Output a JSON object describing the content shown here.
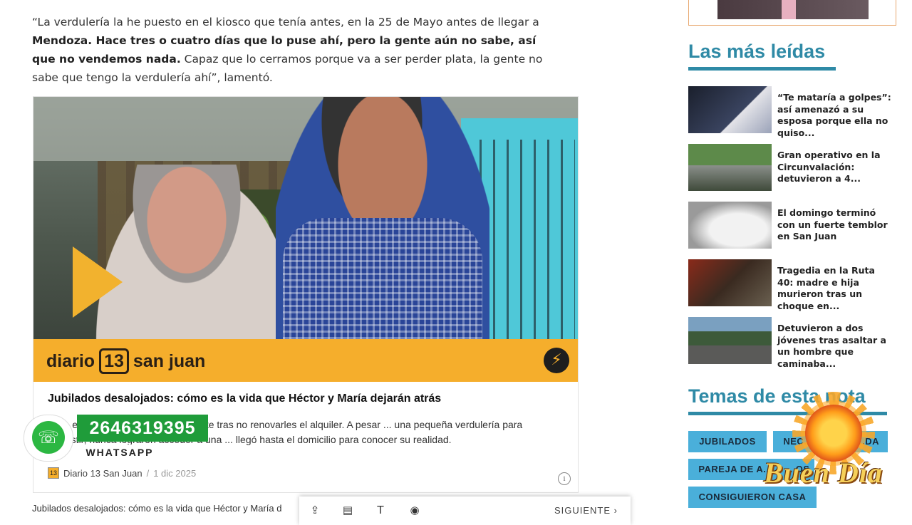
{
  "article": {
    "paragraph_part1": "“La verdulería la he puesto en el kiosco que tenía antes, en la 25 de Mayo antes de llegar a ",
    "paragraph_bold": "Mendoza. Hace tres o cuatro días que lo puse ahí, pero la gente aún no sabe, así que no vendemos nada.",
    "paragraph_part2": " Capaz que lo cerramos porque va a ser perder plata, la gente no sabe que tengo la verdulería ahí”, lamentó."
  },
  "embed": {
    "brand_left": "diario",
    "brand_box": "13",
    "brand_right": "san juan",
    "title": "Jubilados desalojados: cómo es la vida que Héctor y María dejarán atrás",
    "description": "...os, enfrentan un desalojo inminente tras no renovarles el alquiler. A pesar ... una pequeña verdulería para subsistir, nunca lograron acceder a una ... llegó hasta el domicilio para conocer su realidad.",
    "source": "Diario 13 San Juan",
    "separator": "/",
    "date": "1 dic 2025",
    "source_logo": "13",
    "info_icon": "i"
  },
  "caption": "Jubilados desalojados: cómo es la vida que Héctor y María d",
  "whatsapp": {
    "number": "2646319395",
    "label": "WHATSAPP"
  },
  "toolbar": {
    "next_label": "SIGUIENTE"
  },
  "sidebar": {
    "most_read_title": "Las más leídas",
    "most_read": [
      {
        "title": "“Te mataría a golpes”: así amenazó a su esposa porque ella no quiso..."
      },
      {
        "title": "Gran operativo en la Circunvalación: detuvieron a 4..."
      },
      {
        "title": "El domingo terminó con un fuerte temblor en San Juan"
      },
      {
        "title": "Tragedia en la Ruta 40: madre e hija murieron tras un choque en..."
      },
      {
        "title": "Detuvieron a dos jóvenes tras asaltar a un hombre que caminaba..."
      }
    ],
    "topics_title": "Temas de esta nota",
    "tags": [
      "JUBILADOS",
      "NEC...",
      "...DA",
      "PAREJA DE A...",
      "...OS",
      "CONSIGUIERON CASA"
    ]
  },
  "overlay": {
    "logo_text": "Buen Día"
  },
  "colors": {
    "accent": "#2f8aa6",
    "tag_bg": "#4aafda",
    "brand_orange": "#f5ae2c",
    "whatsapp_green": "#1f9c3a"
  }
}
